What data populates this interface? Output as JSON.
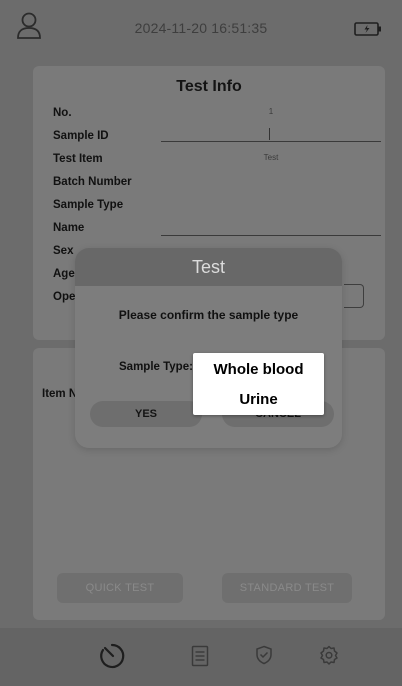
{
  "status_bar": {
    "datetime": "2024-11-20  16:51:35",
    "user_icon": "user-icon",
    "battery_icon": "battery-charging-icon"
  },
  "test_info": {
    "title": "Test Info",
    "fields": [
      {
        "label": "No.",
        "value": "1"
      },
      {
        "label": "Sample ID",
        "value": ""
      },
      {
        "label": "Test Item",
        "value": "Test"
      },
      {
        "label": "Batch Number",
        "value": ""
      },
      {
        "label": "Sample Type",
        "value": ""
      },
      {
        "label": "Name",
        "value": ""
      },
      {
        "label": "Sex",
        "value": ""
      },
      {
        "label": "Age",
        "value": ""
      },
      {
        "label": "Oper",
        "value": ""
      }
    ]
  },
  "item_panel": {
    "label": "Item N"
  },
  "actions": {
    "quick_test": "QUICK TEST",
    "standard_test": "STANDARD TEST"
  },
  "dialog": {
    "title": "Test",
    "message": "Please confirm the sample type",
    "sample_type_label": "Sample Type:",
    "yes": "YES",
    "cancel": "CANCEL"
  },
  "dropdown": {
    "options": [
      "Whole blood",
      "Urine"
    ]
  },
  "nav": {
    "icons": [
      "timer-icon",
      "list-icon",
      "shield-check-icon",
      "settings-icon"
    ]
  },
  "colors": {
    "dim_background": "#6c6c6c",
    "dropdown_bg": "#ffffff"
  }
}
